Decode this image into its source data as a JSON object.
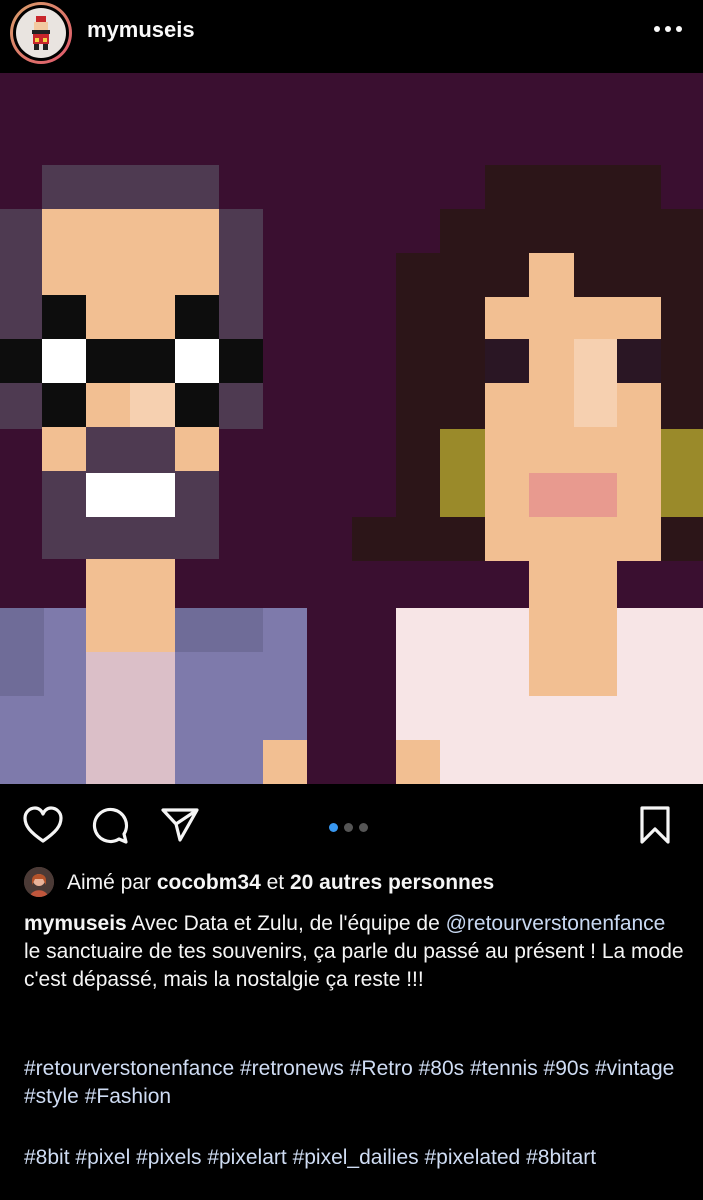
{
  "header": {
    "username": "mymuseis",
    "more_icon": "more-horizontal-icon"
  },
  "post": {
    "carousel_pages": 3,
    "carousel_active_index": 0
  },
  "actions": {
    "like_icon": "heart-icon",
    "comment_icon": "comment-icon",
    "share_icon": "paper-plane-icon",
    "save_icon": "bookmark-icon"
  },
  "likes": {
    "prefix": "Aimé par",
    "user": "cocobm34",
    "connector": "et",
    "others": "20 autres personnes"
  },
  "caption": {
    "username": "mymuseis",
    "text_1": "Avec Data et Zulu, de l'équipe de",
    "mention": "@retourverstonenfance",
    "text_2": "le sanctuaire de tes souvenirs, ça parle du passé au présent ! La mode c'est dépassé, mais la nostalgie ça reste !!!"
  },
  "hashtags_1": [
    "#retourverstonenfance",
    "#retronews",
    "#Retro",
    "#80s",
    "#tennis",
    "#90s",
    "#vintage",
    "#style",
    "#Fashion"
  ],
  "hashtags_2": [
    "#8bit",
    "#pixel",
    "#pixels",
    "#pixelart",
    "#pixel_dailies",
    "#pixelated",
    "#8bitart"
  ],
  "colors": {
    "background": "#000000",
    "image_bg": "#3a0f30",
    "accent_dot": "#3897f0",
    "hashtag": "#cfdcf3"
  }
}
